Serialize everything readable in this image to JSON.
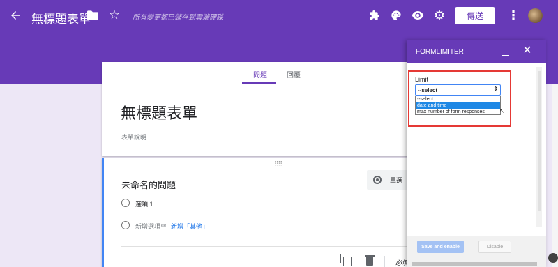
{
  "header": {
    "doc_title": "無標題表單",
    "save_status": "所有變更都已儲存到雲端硬碟",
    "send_label": "傳送",
    "icons": [
      "back-icon",
      "folder-icon",
      "star-icon",
      "addon-icon",
      "palette-icon",
      "eye-icon",
      "gear-icon",
      "more-icon"
    ]
  },
  "form": {
    "tabs": [
      "問題",
      "回覆"
    ],
    "active_tab": "問題",
    "title": "無標題表單",
    "description": "表單說明"
  },
  "question": {
    "title": "未命名的問題",
    "type": "單選",
    "option_1": "選項 1",
    "add_option": "新增選項",
    "or": "or",
    "add_other": "新增「其他」",
    "required": "必填"
  },
  "panel": {
    "title": "FORMLIMITER",
    "limit_label": "Limit",
    "select_value": "--select",
    "options": [
      "--select",
      "date and time",
      "max number of form responses"
    ],
    "highlighted_option": "date and time",
    "save_button": "Save and enable",
    "disable_button": "Disable"
  },
  "colors": {
    "brand": "#673ab7",
    "highlight": "#e53935",
    "option_selected": "#1e88e5"
  }
}
